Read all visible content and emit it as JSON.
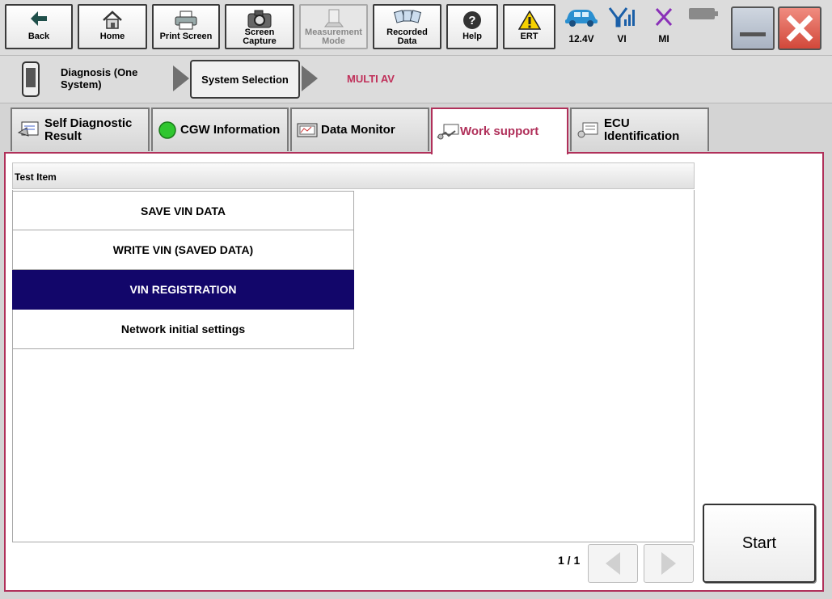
{
  "toolbar": {
    "back": "Back",
    "home": "Home",
    "print_screen": "Print Screen",
    "screen_capture": "Screen\nCapture",
    "measurement_mode": "Measurement\nMode",
    "recorded_data": "Recorded\nData",
    "help": "Help",
    "ert": "ERT"
  },
  "status": {
    "voltage": "12.4V",
    "vi": "VI",
    "mi": "MI"
  },
  "breadcrumb": {
    "diagnosis": "Diagnosis (One\nSystem)",
    "system_selection": "System Selection",
    "current": "MULTI AV"
  },
  "tabs": [
    {
      "label": "Self Diagnostic\nResult"
    },
    {
      "label": "CGW Information"
    },
    {
      "label": "Data Monitor"
    },
    {
      "label": "Work support"
    },
    {
      "label": "ECU\nIdentification"
    }
  ],
  "list": {
    "header": "Test Item",
    "items": [
      {
        "label": "SAVE VIN DATA"
      },
      {
        "label": "WRITE VIN (SAVED DATA)"
      },
      {
        "label": "VIN REGISTRATION"
      },
      {
        "label": "Network initial settings"
      }
    ],
    "page": "1 / 1"
  },
  "start_label": "Start",
  "colors": {
    "accent": "#b0305a",
    "selected_row": "#12066a"
  }
}
